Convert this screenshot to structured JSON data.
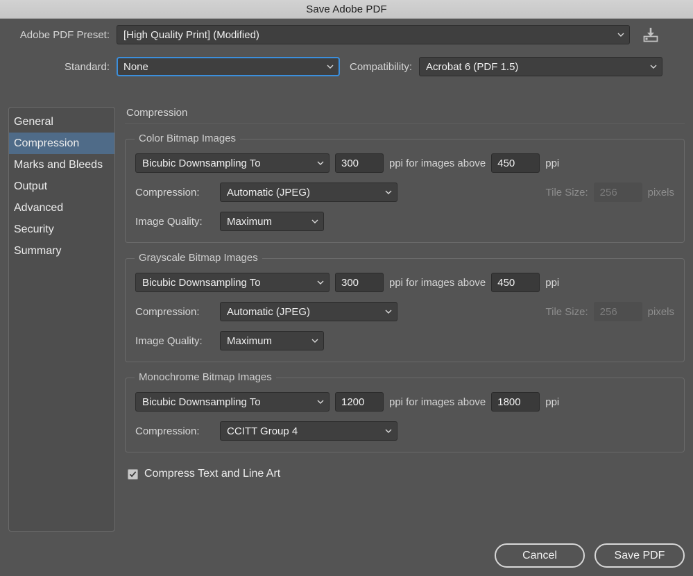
{
  "window": {
    "title": "Save Adobe PDF"
  },
  "header": {
    "preset_label": "Adobe PDF Preset:",
    "preset_value": "[High Quality Print] (Modified)",
    "save_preset_icon": "save-preset-icon",
    "standard_label": "Standard:",
    "standard_value": "None",
    "compatibility_label": "Compatibility:",
    "compatibility_value": "Acrobat 6 (PDF 1.5)"
  },
  "sidebar": {
    "items": [
      {
        "label": "General",
        "selected": false
      },
      {
        "label": "Compression",
        "selected": true
      },
      {
        "label": "Marks and Bleeds",
        "selected": false
      },
      {
        "label": "Output",
        "selected": false
      },
      {
        "label": "Advanced",
        "selected": false
      },
      {
        "label": "Security",
        "selected": false
      },
      {
        "label": "Summary",
        "selected": false
      }
    ]
  },
  "panel": {
    "title": "Compression",
    "groups": [
      {
        "legend": "Color Bitmap Images",
        "resample_value": "Bicubic Downsampling To",
        "ppi_value": "300",
        "ppi_mid_label": "ppi for images above",
        "above_value": "450",
        "ppi_tail_label": "ppi",
        "compression_label": "Compression:",
        "compression_value": "Automatic (JPEG)",
        "tile_label": "Tile Size:",
        "tile_value": "256",
        "tile_units": "pixels",
        "quality_label": "Image Quality:",
        "quality_value": "Maximum"
      },
      {
        "legend": "Grayscale Bitmap Images",
        "resample_value": "Bicubic Downsampling To",
        "ppi_value": "300",
        "ppi_mid_label": "ppi for images above",
        "above_value": "450",
        "ppi_tail_label": "ppi",
        "compression_label": "Compression:",
        "compression_value": "Automatic (JPEG)",
        "tile_label": "Tile Size:",
        "tile_value": "256",
        "tile_units": "pixels",
        "quality_label": "Image Quality:",
        "quality_value": "Maximum"
      },
      {
        "legend": "Monochrome Bitmap Images",
        "resample_value": "Bicubic Downsampling To",
        "ppi_value": "1200",
        "ppi_mid_label": "ppi for images above",
        "above_value": "1800",
        "ppi_tail_label": "ppi",
        "compression_label": "Compression:",
        "compression_value": "CCITT Group 4"
      }
    ],
    "compress_text_label": "Compress Text and Line Art",
    "compress_text_checked": true
  },
  "footer": {
    "cancel_label": "Cancel",
    "save_label": "Save PDF"
  },
  "colors": {
    "dialog_bg": "#545454",
    "titlebar_bg": "#c8c8c8",
    "selection_blue": "#4f6b88",
    "focus_blue": "#3b8fdd",
    "input_bg": "#3a3a3a",
    "text": "#ececec",
    "text_dim": "#8d8d8d"
  }
}
